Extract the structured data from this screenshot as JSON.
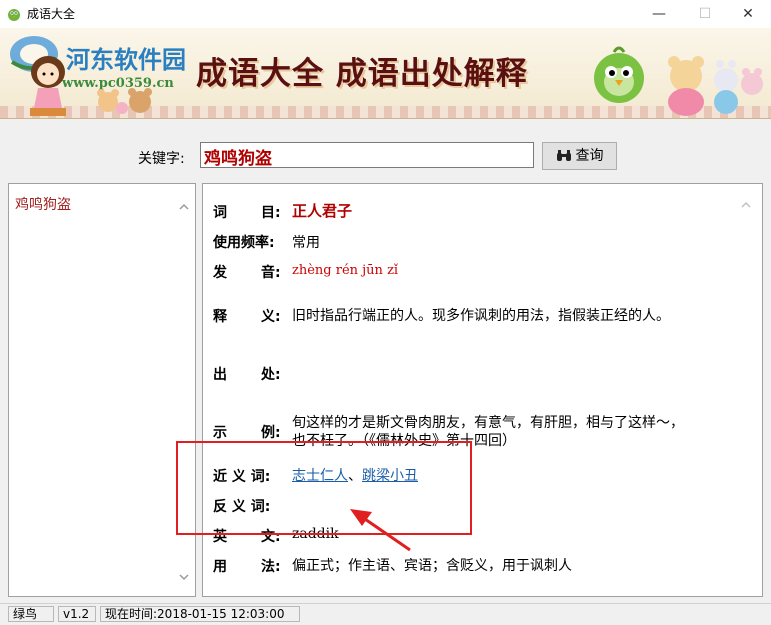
{
  "window": {
    "title": "成语大全",
    "minimize": "—",
    "maximize": "☐",
    "close": "✕"
  },
  "banner": {
    "watermark_site": "河东软件园",
    "watermark_url": "www.pc0359.cn",
    "title": "成语大全  成语出处解释"
  },
  "search": {
    "label": "关键字:",
    "value": "鸡鸣狗盗",
    "button": "查询"
  },
  "list": {
    "items": [
      "鸡鸣狗盗"
    ]
  },
  "detail": {
    "ci_label": [
      "词",
      "目:"
    ],
    "ci_value": "正人君子",
    "freq_label": "使用频率:",
    "freq_value": "常用",
    "pron_label": [
      "发",
      "音:"
    ],
    "pron_value": "zhèng rén jūn zǐ",
    "shi_label": [
      "释",
      "义:"
    ],
    "shi_value": "旧时指品行端正的人。现多作讽刺的用法，指假装正经的人。",
    "chu_label": [
      "出",
      "处:"
    ],
    "chu_value": "",
    "example_label": [
      "示",
      "例:"
    ],
    "example_line1": "旬这样的才是斯文骨肉朋友，有意气，有肝胆，相与了这样～，",
    "example_line2": "也不枉了。（《儒林外史》第十四回）",
    "syn_label": "近 义 词:",
    "syn_1": "志士仁人",
    "syn_sep": "、",
    "syn_2": "跳梁小丑",
    "ant_label": "反 义 词:",
    "ant_value": "",
    "en_label": [
      "英",
      "文:"
    ],
    "en_value": "zaddik",
    "usage_label": [
      "用",
      "法:"
    ],
    "usage_value": "偏正式；作主语、宾语；含贬义，用于讽刺人"
  },
  "status": {
    "user": "绿鸟",
    "version": "v1.2",
    "time": "现在时间:2018-01-15 12:03:00"
  }
}
